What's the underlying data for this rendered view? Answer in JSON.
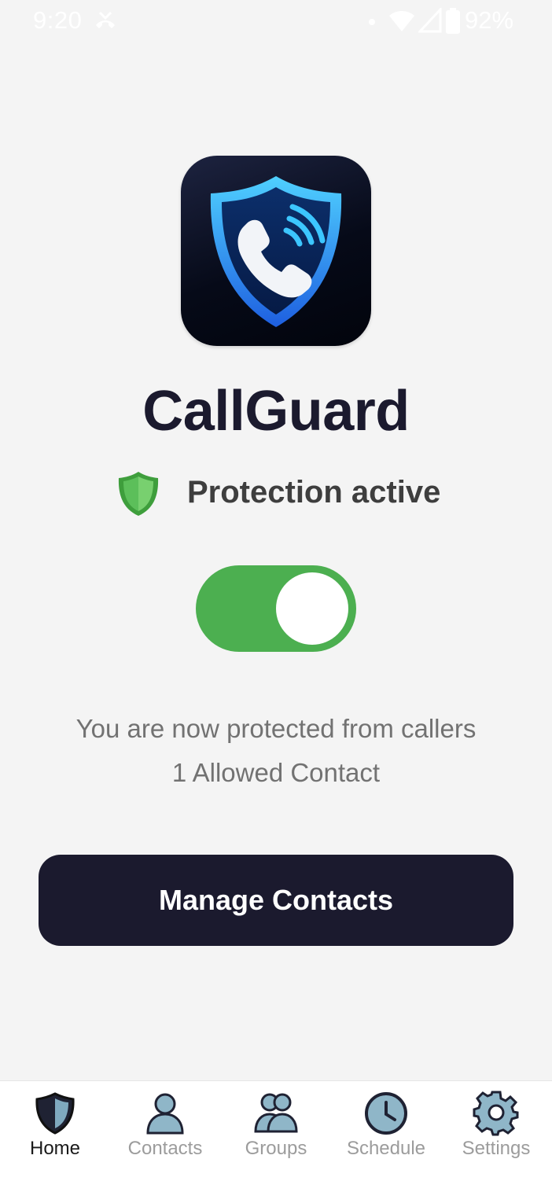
{
  "status_bar": {
    "time": "9:20",
    "battery_percent": "92%",
    "icons": [
      "missed-call-icon",
      "dot-icon",
      "wifi-icon",
      "signal-icon",
      "battery-icon"
    ]
  },
  "app": {
    "name": "CallGuard",
    "icon": "shield-phone-icon"
  },
  "protection": {
    "status_label": "Protection active",
    "status_icon": "shield-green-icon",
    "enabled": true
  },
  "info": {
    "line1": "You are now protected from callers",
    "line2": "1 Allowed Contact"
  },
  "manage_button": {
    "label": "Manage Contacts"
  },
  "bottom_nav": {
    "items": [
      {
        "label": "Home",
        "icon": "shield-icon",
        "active": true
      },
      {
        "label": "Contacts",
        "icon": "person-icon",
        "active": false
      },
      {
        "label": "Groups",
        "icon": "group-icon",
        "active": false
      },
      {
        "label": "Schedule",
        "icon": "clock-icon",
        "active": false
      },
      {
        "label": "Settings",
        "icon": "gear-icon",
        "active": false
      }
    ]
  },
  "colors": {
    "background": "#f4f4f4",
    "primary_dark": "#1b1a2e",
    "toggle_on": "#4caf50",
    "shield_green": "#5cbf5a",
    "nav_icon_fill": "#8fb6c8",
    "accent_blue": "#2fa6ff"
  }
}
